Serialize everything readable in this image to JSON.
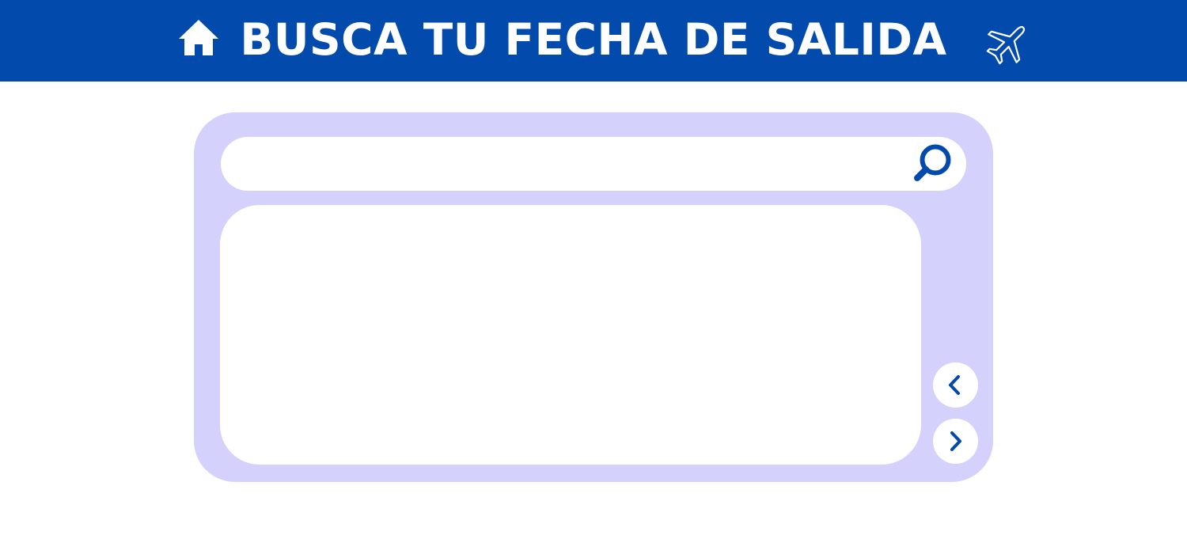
{
  "header": {
    "title": "BUSCA TU FECHA DE SALIDA",
    "home_icon": "home-icon",
    "plane_icon": "airplane-icon"
  },
  "search": {
    "value": "",
    "placeholder": "",
    "icon": "search-icon"
  },
  "pager": {
    "prev_icon": "chevron-left-icon",
    "next_icon": "chevron-right-icon"
  },
  "colors": {
    "brand_blue": "#034aad",
    "panel_lavender": "#d4d1fd",
    "white": "#ffffff"
  }
}
